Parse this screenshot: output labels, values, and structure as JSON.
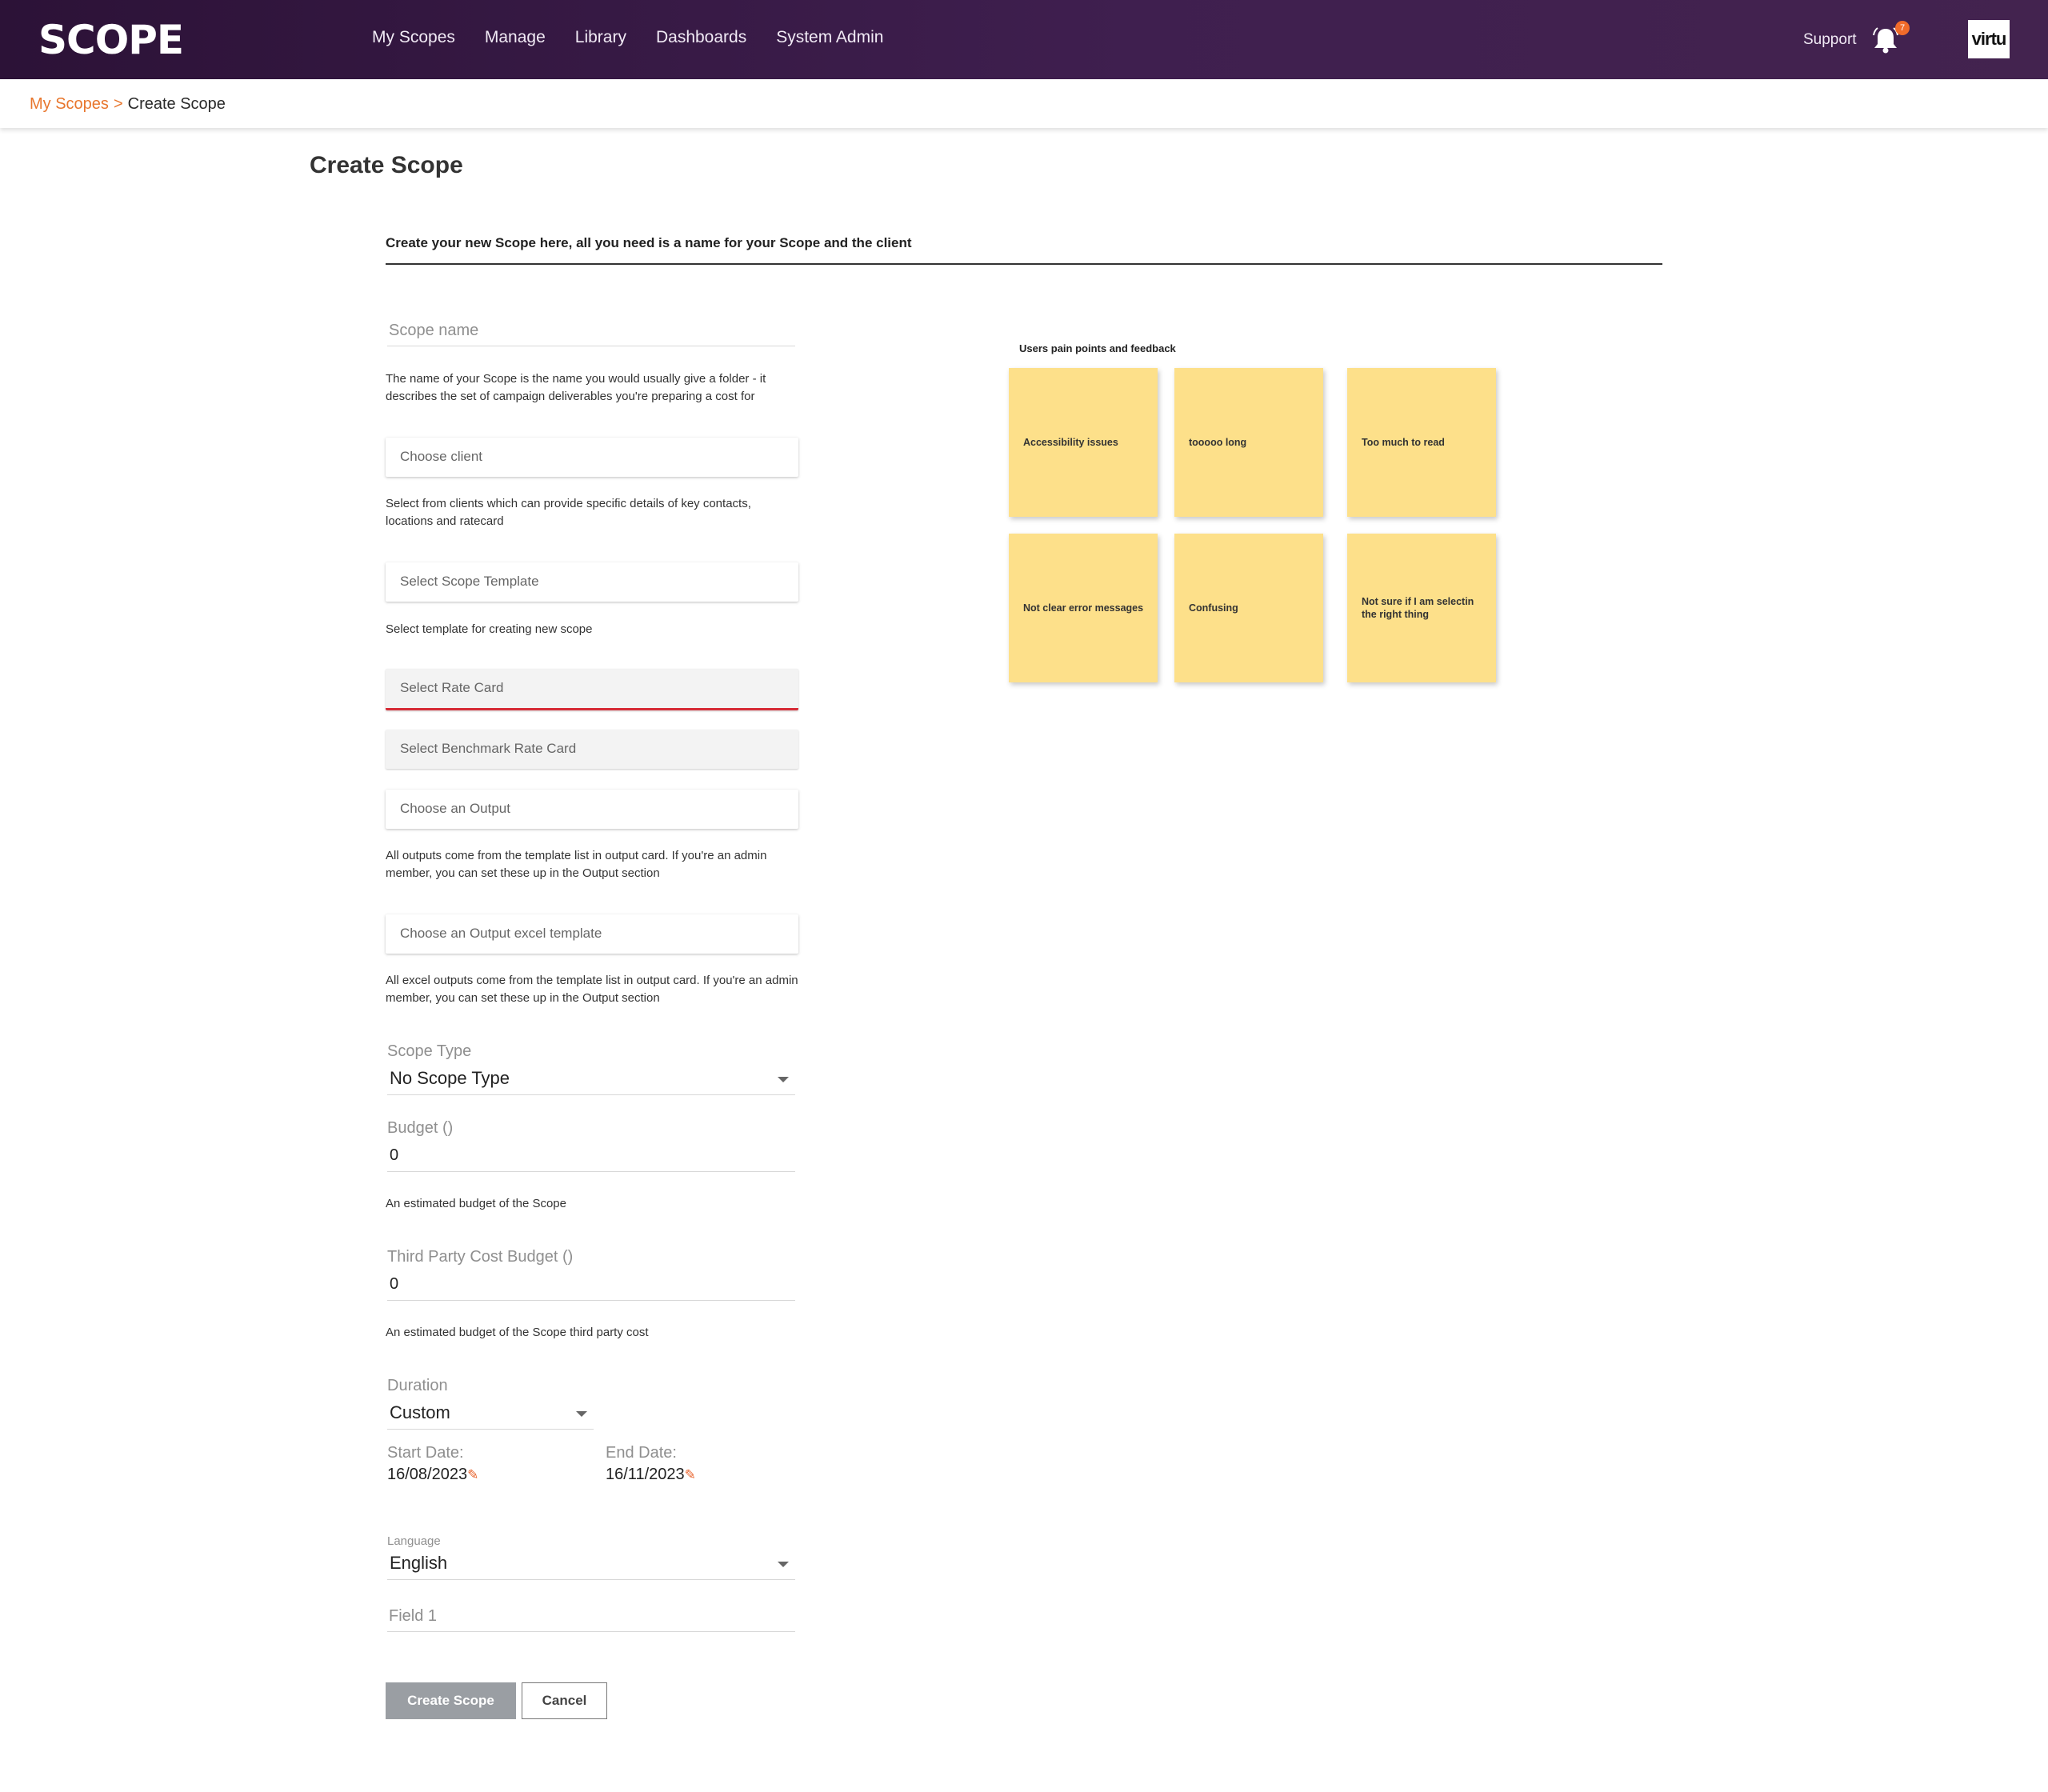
{
  "nav": {
    "logo": "SCOPE",
    "items": [
      "My Scopes",
      "Manage",
      "Library",
      "Dashboards",
      "System Admin"
    ],
    "support": "Support",
    "notification_count": "7",
    "account": "virtu"
  },
  "breadcrumb": {
    "parent": "My Scopes",
    "separator": ">",
    "current": "Create Scope"
  },
  "page": {
    "title": "Create Scope",
    "intro": "Create your new Scope here, all you need is a name for your Scope and the client"
  },
  "form": {
    "scope_name": {
      "placeholder": "Scope name",
      "help": "The name of your Scope is the name you would usually give a folder - it describes the set of campaign deliverables you're preparing a cost for"
    },
    "client": {
      "placeholder": "Choose client",
      "help": "Select from clients which can provide specific details of key contacts, locations and ratecard"
    },
    "template": {
      "placeholder": "Select Scope Template",
      "help": "Select template for creating new scope"
    },
    "rate_card": {
      "placeholder": "Select Rate Card"
    },
    "benchmark_rate_card": {
      "placeholder": "Select Benchmark Rate Card"
    },
    "output": {
      "placeholder": "Choose an Output",
      "help": "All outputs come from the template list in output card. If you're an admin member, you can set these up in the Output section"
    },
    "output_excel": {
      "placeholder": "Choose an Output excel template",
      "help": "All excel outputs come from the template list in output card. If you're an admin member, you can set these up in the Output section"
    },
    "scope_type": {
      "label": "Scope Type",
      "value": "No Scope Type"
    },
    "budget": {
      "label": "Budget ()",
      "value": "0",
      "help": "An estimated budget of the Scope"
    },
    "third_party_budget": {
      "label": "Third Party Cost Budget ()",
      "value": "0",
      "help": "An estimated budget of the Scope third party cost"
    },
    "duration": {
      "label": "Duration",
      "value": "Custom"
    },
    "start_date": {
      "label": "Start Date:",
      "value": "16/08/2023"
    },
    "end_date": {
      "label": "End Date:",
      "value": "16/11/2023"
    },
    "language": {
      "label": "Language",
      "value": "English"
    },
    "field1": {
      "placeholder": "Field 1"
    },
    "create_button": "Create Scope",
    "cancel_button": "Cancel"
  },
  "feedback": {
    "title": "Users pain points and feedback",
    "notes": [
      "Accessibility issues",
      "tooooo long",
      "Too much to read",
      "Not clear error messages",
      "Confusing",
      "Not sure if I am selectin the right thing"
    ],
    "note_color": "#fde08a"
  },
  "colors": {
    "header_bg": "#3a1a48",
    "accent": "#e8762d",
    "error": "#d62b36"
  }
}
